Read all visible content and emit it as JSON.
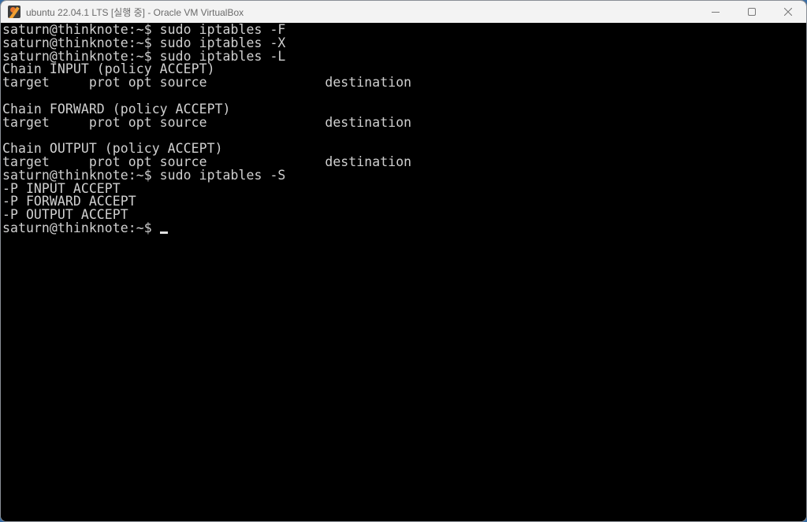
{
  "window": {
    "title": "ubuntu 22.04.1 LTS [실행 중] - Oracle VM VirtualBox",
    "app_icon": "virtualbox-icon",
    "controls": {
      "minimize": "minimize-icon",
      "maximize": "maximize-icon",
      "close": "close-icon"
    }
  },
  "terminal": {
    "prompt": "saturn@thinknote:~$ ",
    "lines": [
      "saturn@thinknote:~$ sudo iptables -F",
      "saturn@thinknote:~$ sudo iptables -X",
      "saturn@thinknote:~$ sudo iptables -L",
      "Chain INPUT (policy ACCEPT)",
      "target     prot opt source               destination",
      "",
      "Chain FORWARD (policy ACCEPT)",
      "target     prot opt source               destination",
      "",
      "Chain OUTPUT (policy ACCEPT)",
      "target     prot opt source               destination",
      "saturn@thinknote:~$ sudo iptables -S",
      "-P INPUT ACCEPT",
      "-P FORWARD ACCEPT",
      "-P OUTPUT ACCEPT"
    ],
    "current_input": ""
  },
  "colors": {
    "terminal_bg": "#000000",
    "terminal_fg": "#d0d0d0",
    "titlebar_bg": "#f3f3f3"
  }
}
